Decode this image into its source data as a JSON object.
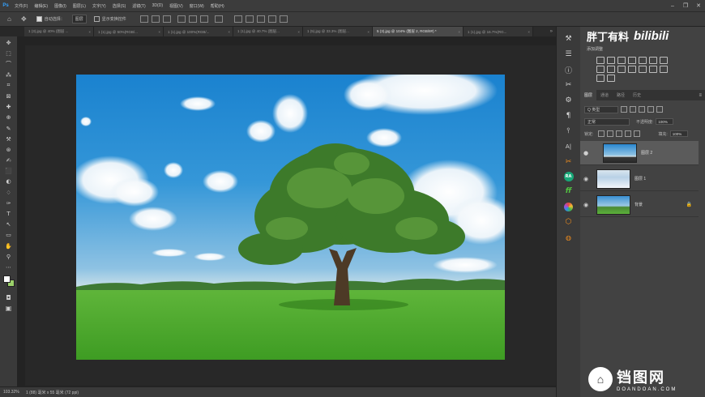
{
  "menubar": {
    "logo": "Ps",
    "items": [
      "文件(F)",
      "编辑(E)",
      "图像(I)",
      "图层(L)",
      "文字(Y)",
      "选择(S)",
      "滤镜(T)",
      "3D(D)",
      "视图(V)",
      "窗口(W)",
      "帮助(H)"
    ],
    "window_controls": [
      "–",
      "❐",
      "✕"
    ]
  },
  "optbar": {
    "home_icon": "⌂",
    "move_icon": "✥",
    "auto_select_label": "自动选择：",
    "auto_select_value": "图层",
    "show_transform_label": "显示变换控件"
  },
  "tabs": [
    {
      "label": "1 (3).jpg @ 40% (图层 ...",
      "close": "×",
      "active": false
    },
    {
      "label": "1 (1).jpg @ 50%(RGB/...",
      "close": "×",
      "active": false
    },
    {
      "label": "1 (1).jpg @ 100%(RGB/...",
      "close": "×",
      "active": false
    },
    {
      "label": "1 (1).jpg @ 40.7% (图层...",
      "close": "×",
      "active": false
    },
    {
      "label": "1 (5).jpg @ 33.3% (图层...",
      "close": "×",
      "active": false
    },
    {
      "label": "5 (3).jpg @ 104% (图层 2, RGB/8#) *",
      "close": "×",
      "active": true
    },
    {
      "label": "1 (1).jpg @ 16.7%(RG...",
      "close": "×",
      "active": false
    }
  ],
  "tabs_more": "»",
  "tools": [
    "✥",
    "⬚",
    "⌒",
    "⁂",
    "⌗",
    "⊠",
    "✚",
    "⊕",
    "✎",
    "⚒",
    "⊛",
    "✍",
    "⬛",
    "◐",
    "♢",
    "✑",
    "T",
    "↖",
    "▭",
    "✋",
    "⚲",
    "⋯"
  ],
  "statusbar": {
    "zoom": "103.32%",
    "doc": "1 (88) 毫米 x 55 毫米 (72 ppi)"
  },
  "iconstrip": [
    "⚒",
    "☰",
    "ⓘ",
    "✂",
    "⚙",
    "¶",
    "⫯",
    "A|",
    "✂"
  ],
  "iconstrip_badges": {
    "ra": "RA",
    "green": "ff",
    "orange": "⬡"
  },
  "panels": {
    "watermark_top_text": "胖丁有料",
    "watermark_top_logo": "bilibili",
    "adjust_title": "添加调整",
    "tabs": [
      "图层",
      "通道",
      "路径",
      "历史"
    ],
    "panel_menu": "≡",
    "filter_kind": "Q 类型",
    "blend_mode": "正常",
    "opacity_label": "不透明度:",
    "opacity_value": "100%",
    "lock_label": "锁定:",
    "fill_label": "填充:",
    "fill_value": "100%"
  },
  "layers": [
    {
      "name": "图层 2",
      "eye": "●",
      "selected": true,
      "locked": false
    },
    {
      "name": "图层 1",
      "eye": "◉",
      "selected": false,
      "locked": false
    },
    {
      "name": "背景",
      "eye": "◉",
      "selected": false,
      "locked": true,
      "lock_icon": "🔒"
    }
  ],
  "watermark_bottom": {
    "logo": "⌂",
    "text": "铛图网",
    "sub": "DOANDOAN.COM"
  }
}
